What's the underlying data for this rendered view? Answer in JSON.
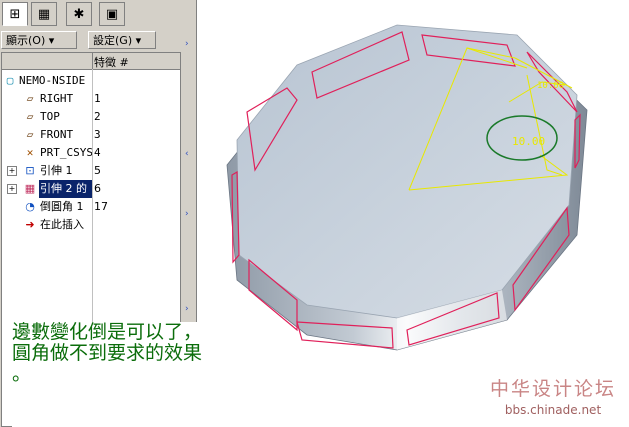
{
  "tabs": [
    {
      "icon": "model-tree-icon",
      "glyph": "⊞",
      "active": true
    },
    {
      "icon": "layers-icon",
      "glyph": "▦",
      "active": false
    },
    {
      "icon": "favorites-icon",
      "glyph": "✱",
      "active": false
    },
    {
      "icon": "folder-icon",
      "glyph": "▣",
      "active": false
    }
  ],
  "menus": {
    "display_label": "顯示(O) ▾",
    "settings_label": "設定(G) ▾"
  },
  "tree": {
    "column_feature": "特徵 #",
    "items": [
      {
        "label": "NEMO-NSIDE",
        "num": "",
        "icon": "part-icon",
        "glyph": "▢",
        "color": "#1a8fb0"
      },
      {
        "label": "RIGHT",
        "num": "1",
        "icon": "datum-plane-icon",
        "glyph": "▱",
        "color": "#603000"
      },
      {
        "label": "TOP",
        "num": "2",
        "icon": "datum-plane-icon",
        "glyph": "▱",
        "color": "#603000"
      },
      {
        "label": "FRONT",
        "num": "3",
        "icon": "datum-plane-icon",
        "glyph": "▱",
        "color": "#603000"
      },
      {
        "label": "PRT_CSYS",
        "num": "4",
        "icon": "coordinate-system-icon",
        "glyph": "✕",
        "color": "#a05000"
      },
      {
        "label": "引伸 1",
        "num": "5",
        "icon": "extrude-icon",
        "glyph": "⊡",
        "color": "#1050c0"
      },
      {
        "label": "引伸 2 的",
        "num": "6",
        "icon": "extrude-pattern-icon",
        "glyph": "▦",
        "color": "#c03060"
      },
      {
        "label": "倒圓角 1",
        "num": "17",
        "icon": "round-icon",
        "glyph": "◔",
        "color": "#1050c0"
      },
      {
        "label": "在此插入",
        "num": "",
        "icon": "insert-here-arrow-icon",
        "glyph": "➜",
        "color": "#c00000"
      }
    ]
  },
  "viewport": {
    "dimension_large": "10.00",
    "dimension_small": "10.00"
  },
  "note": {
    "line1": "邊數變化倒是可以了，",
    "line2": "圓角做不到要求的效果",
    "line3": "。"
  },
  "watermark": {
    "title": "中华设计论坛",
    "url": "bbs.chinade.net"
  },
  "colors": {
    "panel": "#d4d0c8",
    "selection": "#0a246a",
    "note_text": "#0b6d0b",
    "edge_highlight": "#e0205a",
    "dimension": "#e8e800"
  }
}
